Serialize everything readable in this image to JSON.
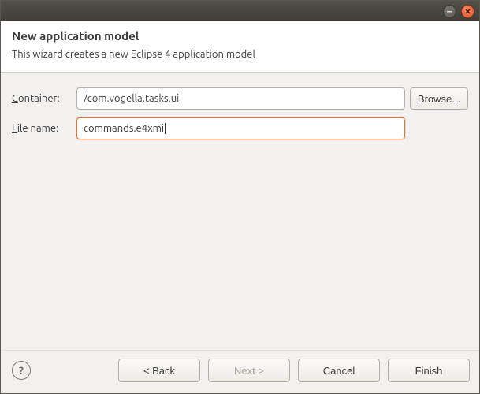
{
  "titlebar": {
    "minimize_icon": "minimize",
    "close_icon": "close"
  },
  "header": {
    "title": "New application model",
    "subtitle": "This wizard creates a new Eclipse 4 application model"
  },
  "form": {
    "container_label_pre": "",
    "container_label_mn": "C",
    "container_label_post": "ontainer:",
    "container_value": "/com.vogella.tasks.ui",
    "browse_label": "Browse...",
    "filename_label_pre": "",
    "filename_label_mn": "F",
    "filename_label_post": "ile name:",
    "filename_value": "commands.e4xmi"
  },
  "footer": {
    "back_label": "< Back",
    "next_label": "Next >",
    "cancel_label": "Cancel",
    "finish_label": "Finish",
    "help_tooltip": "Help"
  }
}
